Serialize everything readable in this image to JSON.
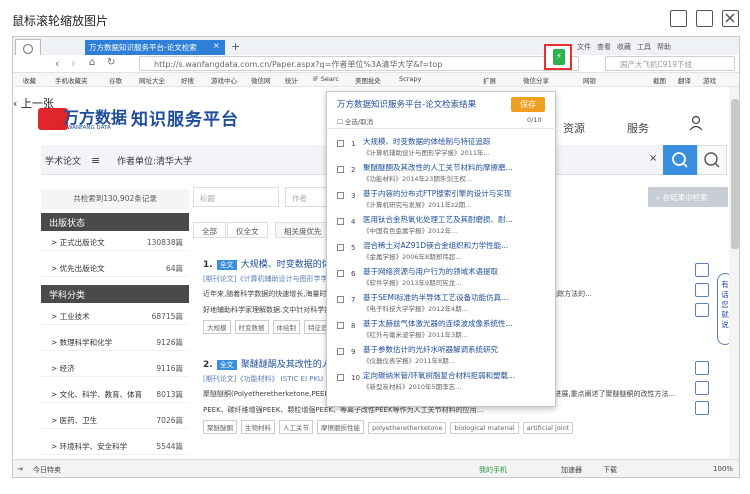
{
  "viewer": {
    "title": "鼠标滚轮缩放图片"
  },
  "browser": {
    "tab_title": "万方数据知识服务平台-论文检索",
    "top_menu": [
      "文件",
      "查看",
      "收藏",
      "工具",
      "帮助"
    ],
    "url": "http://s.wanfangdata.com.cn/Paper.aspx?q=作者单位%3A清华大学&f=top",
    "search_placeholder": "国产大飞机C919下线",
    "bookmarks": [
      "收藏",
      "手机收藏夹",
      "谷歌",
      "网址大全",
      "好搜",
      "游戏中心",
      "微信网",
      "统计",
      "IF Searc",
      "美图批处",
      "Scrapy",
      "扩展",
      "微信分享",
      "网银",
      "截图",
      "翻译",
      "游戏"
    ],
    "status": {
      "left": "今日特卖",
      "phone": "我的手机",
      "items": [
        "加速器",
        "下载"
      ],
      "zoom": "100%"
    }
  },
  "site": {
    "prev_label": "上一张",
    "logo_text": "万方数据",
    "logo_sub": "WANFANG DATA",
    "platform": "知识服务平台",
    "nav": [
      "资源",
      "服务"
    ],
    "search": {
      "field1": "学术论文",
      "field2": "作者单位:清华大学",
      "clear": "×"
    }
  },
  "sidebar": {
    "total": "共检索到130,902条记录",
    "groups": [
      {
        "header": "出版状态",
        "items": [
          {
            "label": "> 正式出版论文",
            "count": "130838篇"
          },
          {
            "label": "> 优先出版论文",
            "count": "64篇"
          }
        ]
      },
      {
        "header": "学科分类",
        "items": [
          {
            "label": "> 工业技术",
            "count": "68715篇"
          },
          {
            "label": "> 数理科学和化学",
            "count": "9126篇"
          },
          {
            "label": "> 经济",
            "count": "9116篇"
          },
          {
            "label": "> 文化、科学、教育、体育",
            "count": "8013篇"
          },
          {
            "label": "> 医药、卫生",
            "count": "7026篇"
          },
          {
            "label": "> 环境科学、安全科学",
            "count": "5544篇"
          }
        ]
      }
    ]
  },
  "filters": {
    "title_placeholder": "标题",
    "author_placeholder": "作者",
    "search_btn": "在结果中检索"
  },
  "sort": {
    "all": "全部",
    "fulltext": "仅全文",
    "relevance": "相关度优先"
  },
  "results": [
    {
      "num": "1.",
      "badge": "全文",
      "title": "大规模、时变数据的体绘制与特征...",
      "meta": "[期刊论文]《计算机辅助设计与图形学学报》...",
      "abstract": "近年来,随着科学数据的快速增长,海量时变数据的可视化成为研究热点...本文在研究大规模时变数据体绘制与特征追踪方法的...",
      "abstract2": "好地辅助科学家理解数据.文中针对科学数据...",
      "keywords": [
        "大规模",
        "时变数据",
        "体绘制",
        "特征追踪"
      ]
    },
    {
      "num": "2.",
      "badge": "全文",
      "title": "聚醚醚酮及其改性的人工...",
      "meta": "[期刊论文]《功能材料》 ISTIC EI PKU",
      "abstract": "聚醚醚酮(Polyetheretherketone,PEEK)优异的力学性能和生物相容性,使其...本文综述了国内外关于PEEK的研究进展,重点阐述了聚醚醚酮的改性方法...",
      "abstract2": "PEEK、碳纤维增强PEEK、颗粒增强PEEK、等离子改性PEEK等作为人工关节材料的应用...",
      "keywords": [
        "聚醚醚酮",
        "生物材料",
        "人工关节",
        "摩擦磨损性能",
        "polyetheretherketone",
        "biological material",
        "artificial joint"
      ]
    }
  ],
  "popup": {
    "title": "万方数据知识服务平台-论文检索结果",
    "save": "保存",
    "select_all": "全选/取消",
    "count": "0/10",
    "items": [
      {
        "idx": "1",
        "title": "大规模、时变数据的体绘制与特征追踪",
        "source": "《计算机辅助设计与图形学学报》2011年..."
      },
      {
        "idx": "2",
        "title": "聚醚醚酮及其改性的人工关节材料的摩擦磨...",
        "source": "《功能材料》2014年23期朱剑王权..."
      },
      {
        "idx": "3",
        "title": "基于内容的分布式FTP搜索引擎的设计与实现",
        "source": "《计算机研究与发展》2011年z2期..."
      },
      {
        "idx": "4",
        "title": "医用钛合金热氧化处理工艺及其耐磨损、耐...",
        "source": "《中国有色金属学报》2012年..."
      },
      {
        "idx": "5",
        "title": "混合稀土对AZ91D镁合金组织和力学性能...",
        "source": "《金属学报》2006年8期郑伟超..."
      },
      {
        "idx": "6",
        "title": "基于网络资源与用户行为的领域术语提取",
        "source": "《软件学报》2013年9期司宪龙..."
      },
      {
        "idx": "7",
        "title": "基于SEMI标准的半导体工艺设备功能仿真...",
        "source": "《电子科技大学学报》2012年4期..."
      },
      {
        "idx": "8",
        "title": "基于太赫兹气体激光器的连续波成像系统性...",
        "source": "《红外与毫米波学报》2011年3期..."
      },
      {
        "idx": "9",
        "title": "基于参数估计的光纤水听器解调系统研究",
        "source": "《仪器仪表学报》2011年8期..."
      },
      {
        "idx": "10",
        "title": "定向碳纳米管/环氧树脂复合材料拒弱和塑载...",
        "source": "《新型炭材料》2010年5期李志..."
      }
    ]
  },
  "feedback": "有话您就说"
}
